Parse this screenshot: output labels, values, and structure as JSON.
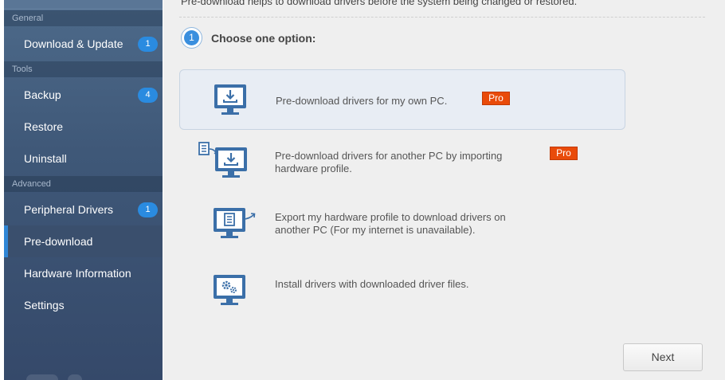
{
  "sidebar": {
    "sections": [
      {
        "title": "General"
      },
      {
        "title": "Tools"
      },
      {
        "title": "Advanced"
      }
    ],
    "items": [
      {
        "label": "Download & Update",
        "badge": "1"
      },
      {
        "label": "Backup",
        "badge": "4"
      },
      {
        "label": "Restore"
      },
      {
        "label": "Uninstall"
      },
      {
        "label": "Peripheral Drivers",
        "badge": "1"
      },
      {
        "label": "Pre-download",
        "active": true
      },
      {
        "label": "Hardware Information"
      },
      {
        "label": "Settings"
      }
    ]
  },
  "main": {
    "intro": "Pre-download helps to download drivers before the system being changed or restored.",
    "step_number": "1",
    "step_title": "Choose one option:",
    "options": [
      {
        "label": "Pre-download drivers for my own PC.",
        "pro": "Pro",
        "icon": "monitor-download-icon"
      },
      {
        "label": "Pre-download drivers for another PC by importing hardware profile.",
        "pro": "Pro",
        "icon": "import-profile-icon"
      },
      {
        "label": "Export my hardware profile to download drivers on another PC (For my internet is unavailable).",
        "icon": "export-profile-icon"
      },
      {
        "label": "Install drivers with downloaded driver files.",
        "icon": "monitor-gear-icon"
      }
    ],
    "next_label": "Next"
  },
  "colors": {
    "accent": "#2f86d6",
    "pro_badge": "#e94b0a",
    "sidebar_bg": "#3f5878",
    "icon_blue": "#3b6fa8"
  }
}
